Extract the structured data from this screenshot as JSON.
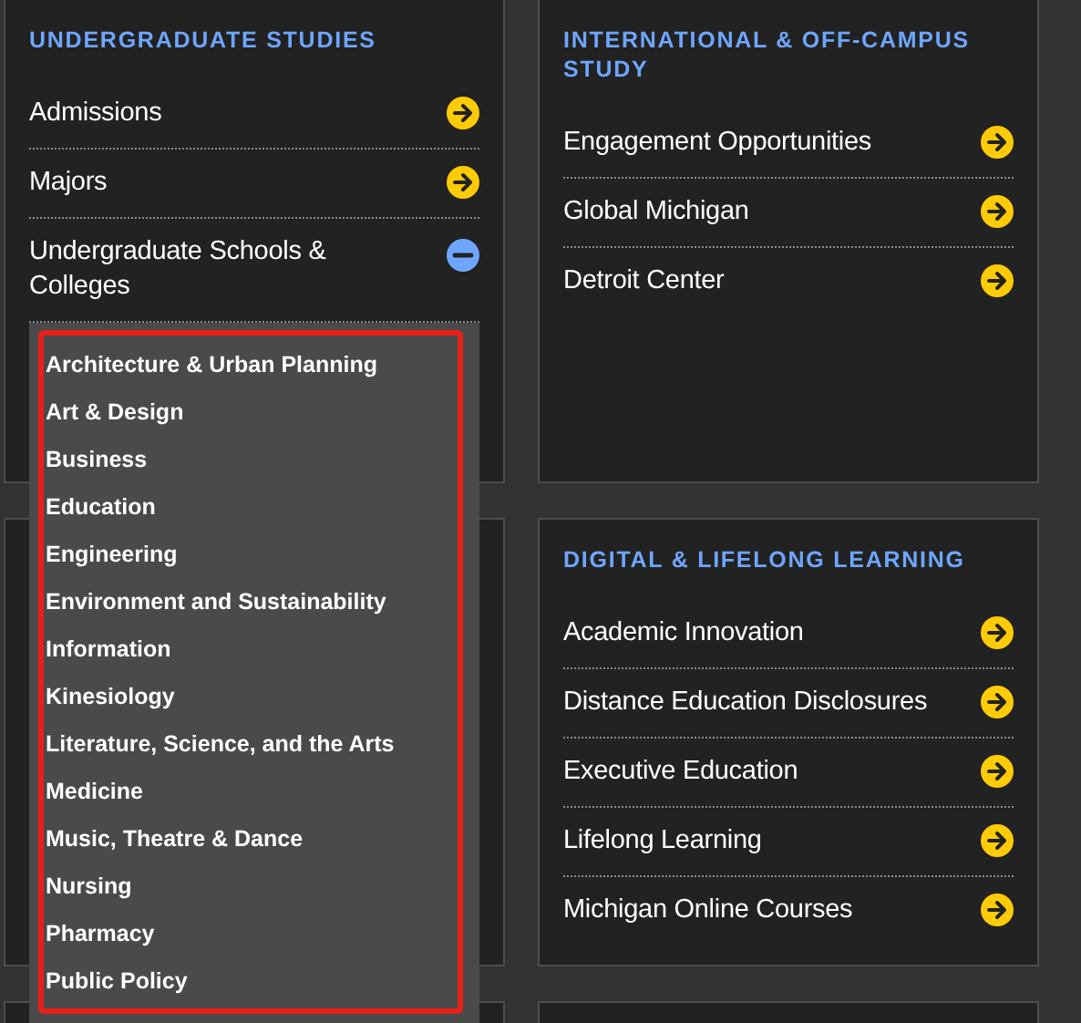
{
  "columns": [
    {
      "sections": [
        {
          "title": "UNDERGRADUATE STUDIES",
          "items": [
            {
              "label": "Admissions",
              "expanded": false
            },
            {
              "label": "Majors",
              "expanded": false
            },
            {
              "label": "Undergraduate Schools & Colleges",
              "expanded": true,
              "highlighted": true,
              "children": [
                "Architecture & Urban Planning",
                "Art & Design",
                "Business",
                "Education",
                "Engineering",
                "Environment and Sustainability",
                "Information",
                "Kinesiology",
                "Literature, Science, and the Arts",
                "Medicine",
                "Music, Theatre & Dance",
                "Nursing",
                "Pharmacy",
                "Public Policy"
              ]
            }
          ]
        },
        {
          "kind": "empty"
        },
        {
          "kind": "empty"
        }
      ]
    },
    {
      "sections": [
        {
          "title": "INTERNATIONAL & OFF-CAMPUS STUDY",
          "items": [
            {
              "label": "Engagement Opportunities",
              "expanded": false
            },
            {
              "label": "Global Michigan",
              "expanded": false
            },
            {
              "label": "Detroit Center",
              "expanded": false
            }
          ]
        },
        {
          "title": "DIGITAL & LIFELONG LEARNING",
          "items": [
            {
              "label": "Academic Innovation",
              "expanded": false
            },
            {
              "label": "Distance Education Disclosures",
              "expanded": false
            },
            {
              "label": "Executive Education",
              "expanded": false
            },
            {
              "label": "Lifelong Learning",
              "expanded": false
            },
            {
              "label": "Michigan Online Courses",
              "expanded": false
            }
          ]
        },
        {
          "kind": "empty"
        }
      ]
    }
  ]
}
